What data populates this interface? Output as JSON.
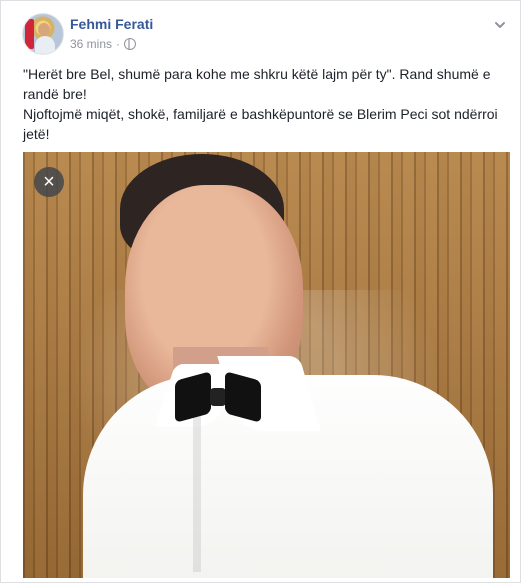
{
  "post": {
    "author": "Fehmi Ferati",
    "time": "36 mins",
    "separator": "·",
    "text_lines": [
      "\"Herët bre Bel, shumë para kohe me shkru këtë lajm për ty\". Rand shumë e randë bre!",
      "Njoftojmë miqët, shokë, familjarë e bashkëpuntorë se Blerim Peci sot ndërroi jetë!"
    ],
    "icons": {
      "privacy": "globe-icon",
      "menu": "chevron-down-icon",
      "close": "close-icon"
    }
  }
}
